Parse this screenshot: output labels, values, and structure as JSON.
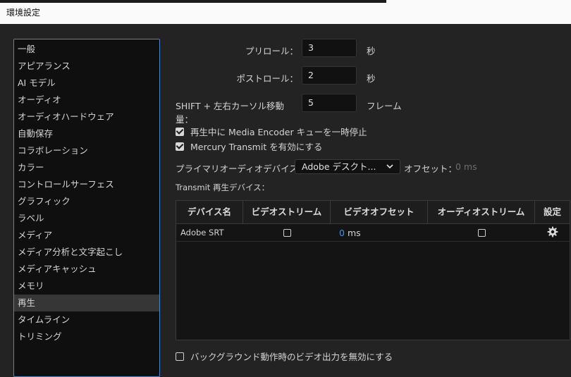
{
  "window": {
    "title": "環境設定"
  },
  "sidebar": {
    "items": [
      {
        "label": "一般"
      },
      {
        "label": "アピアランス"
      },
      {
        "label": "AI モデル"
      },
      {
        "label": "オーディオ"
      },
      {
        "label": "オーディオハードウェア"
      },
      {
        "label": "自動保存"
      },
      {
        "label": "コラボレーション"
      },
      {
        "label": "カラー"
      },
      {
        "label": "コントロールサーフェス"
      },
      {
        "label": "グラフィック"
      },
      {
        "label": "ラベル"
      },
      {
        "label": "メディア"
      },
      {
        "label": "メディア分析と文字起こし"
      },
      {
        "label": "メディアキャッシュ"
      },
      {
        "label": "メモリ"
      },
      {
        "label": "再生",
        "selected": true
      },
      {
        "label": "タイムライン"
      },
      {
        "label": "トリミング"
      }
    ]
  },
  "playback": {
    "preroll": {
      "label": "プリロール：",
      "value": "3",
      "unit": "秒"
    },
    "postroll": {
      "label": "ポストロール：",
      "value": "2",
      "unit": "秒"
    },
    "shift_move": {
      "label": "SHIFT + 左右カーソル移動量：",
      "value": "5",
      "unit": "フレーム"
    },
    "pause_media_encoder": {
      "label": "再生中に Media Encoder キューを一時停止",
      "checked": true
    },
    "mercury_transmit": {
      "label": "Mercury Transmit を有効にする",
      "checked": true
    },
    "audio_device": {
      "label": "プライマリオーディオデバイス：",
      "value": "Adobe デスクト...",
      "offset_label": "オフセット：",
      "offset_value": "0 ms"
    },
    "transmit_devices_label": "Transmit 再生デバイス：",
    "table": {
      "headers": [
        "デバイス名",
        "ビデオストリーム",
        "ビデオオフセット",
        "オーディオストリーム",
        "設定"
      ],
      "rows": [
        {
          "device": "Adobe SRT",
          "video_stream": false,
          "video_offset": "0",
          "video_offset_unit": "ms",
          "audio_stream": false
        }
      ]
    },
    "disable_background": {
      "label": "バックグラウンド動作時のビデオ出力を無効にする",
      "checked": false
    }
  },
  "colors": {
    "selection_border": "#4a86c8",
    "offset_accent": "#4a90e2"
  },
  "icons": {
    "settings": "gear-icon",
    "dropdown": "chevron-down-icon"
  }
}
